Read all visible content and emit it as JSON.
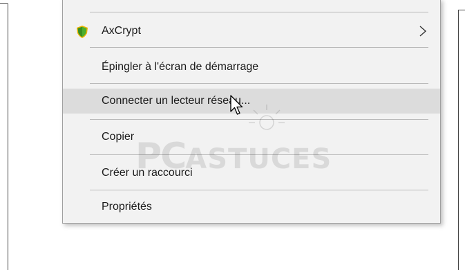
{
  "context_menu": {
    "items": [
      {
        "label": "AxCrypt",
        "has_submenu": true,
        "icon": "axcrypt-shield-icon"
      },
      {
        "label": "Épingler à l'écran de démarrage"
      },
      {
        "label": "Connecter un lecteur réseau...",
        "highlighted": true
      },
      {
        "label": "Copier"
      },
      {
        "label": "Créer un raccourci"
      },
      {
        "label": "Propriétés"
      }
    ]
  },
  "watermark": {
    "text_large": "PC",
    "text_small": "ASTUCES"
  },
  "colors": {
    "menu_background": "#f2f2f2",
    "highlight": "#dcdcdc",
    "separator": "#b8b8b8",
    "icon_green": "#4caf2e",
    "icon_yellow": "#f0b400"
  }
}
